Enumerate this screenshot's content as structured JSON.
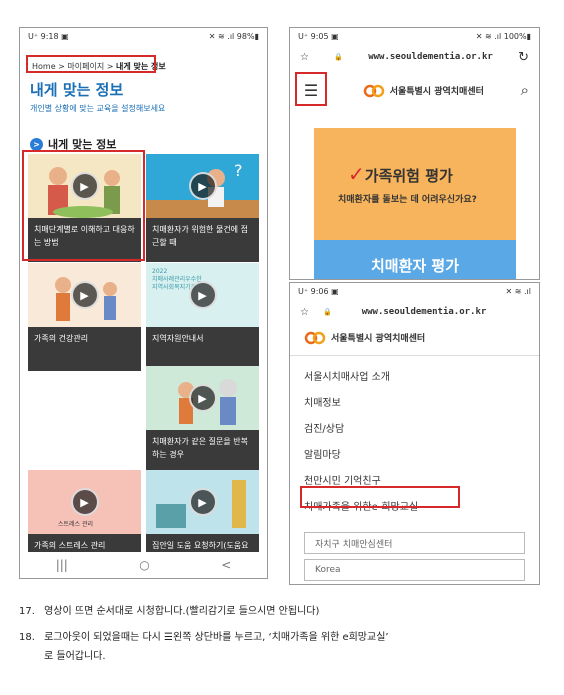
{
  "left_phone": {
    "status_left": "U⁺ 9:18 ▣",
    "status_right": "✕ ≋ .ıl 98%▮",
    "breadcrumb": [
      "Home",
      "마이페이지",
      "내게 맞는 정보"
    ],
    "breadcrumb_sep": ">",
    "title": "내게 맞는 정보",
    "subtitle": "개인별 상황에 맞는 교육을 설정해보세요",
    "section_icon": ">",
    "section_title": "내게 맞는 정보",
    "cards": [
      {
        "caption": "치매단계별로 이해하고 대응하는 방법",
        "bg": "#f6e7c4"
      },
      {
        "caption": "치매환자가 위험한 물건에 접근할 때",
        "bg": "#2fa8d8"
      },
      {
        "caption": "가족의 건강관리",
        "bg": "#f8e9d8"
      },
      {
        "caption": "지역자원안내서",
        "bg": "#d9f0f0",
        "thumb_text": "2022\n치매사례관리우수한\n지역사회복지기관"
      },
      {
        "caption": "치매환자가 같은 질문을 반복하는 경우",
        "bg": "#cfe9d8"
      },
      {
        "caption": "가족의 스트레스 관리",
        "bg": "#f6c2b8",
        "thumb_text": "스트레스 관리"
      },
      {
        "caption": "집안일 도움 요청하기(도움요",
        "bg": "#bfe3ea"
      }
    ],
    "nav": [
      "|||",
      "○",
      "<"
    ]
  },
  "top_right_phone": {
    "status_left": "U⁺ 9:05 ▣",
    "status_right": "✕ ≋ .ıl 100%▮",
    "url_star": "☆",
    "url_lock": "🔒",
    "url": "www.seouldementia.or.kr",
    "reload": "↻",
    "menu_icon": "☰",
    "site_name": "서울특별시 광역치매센터",
    "search_icon": "⌕",
    "banner_title": "가족위험 평가",
    "banner_check": "✓",
    "banner_sub": "치매환자를 돌보는 데 어려우신가요?",
    "banner2_title": "치매환자 평가"
  },
  "bottom_right_phone": {
    "status_left": "U⁺ 9:06 ▣",
    "status_right": "✕ ≋ .ıl",
    "url_star": "☆",
    "url_lock": "🔒",
    "url": "www.seouldementia.or.kr",
    "site_name": "서울특별시 광역치매센터",
    "menu": [
      "서울시치매사업 소개",
      "치매정보",
      "검진/상담",
      "알림마당",
      "천만시민 기억친구",
      "치매가족을 위한e-희망교실"
    ],
    "select1": "자치구 치매안심센터",
    "select2": "Korea"
  },
  "instructions": [
    {
      "num": "17.",
      "text": "영상이 뜨면 순서대로 시청합니다.(빨리감기로 들으시면 안됩니다)"
    },
    {
      "num": "18.",
      "text": "로그아웃이 되었을때는 다시 ☰왼쪽 상단바를 누르고, ‘치매가족을 위한 e희망교실’"
    },
    {
      "num": "",
      "text": "로 들어갑니다."
    }
  ],
  "colors": {
    "highlight": "#d62a2a",
    "brand_blue": "#1a6fb5",
    "banner_orange": "#f7b45c"
  }
}
